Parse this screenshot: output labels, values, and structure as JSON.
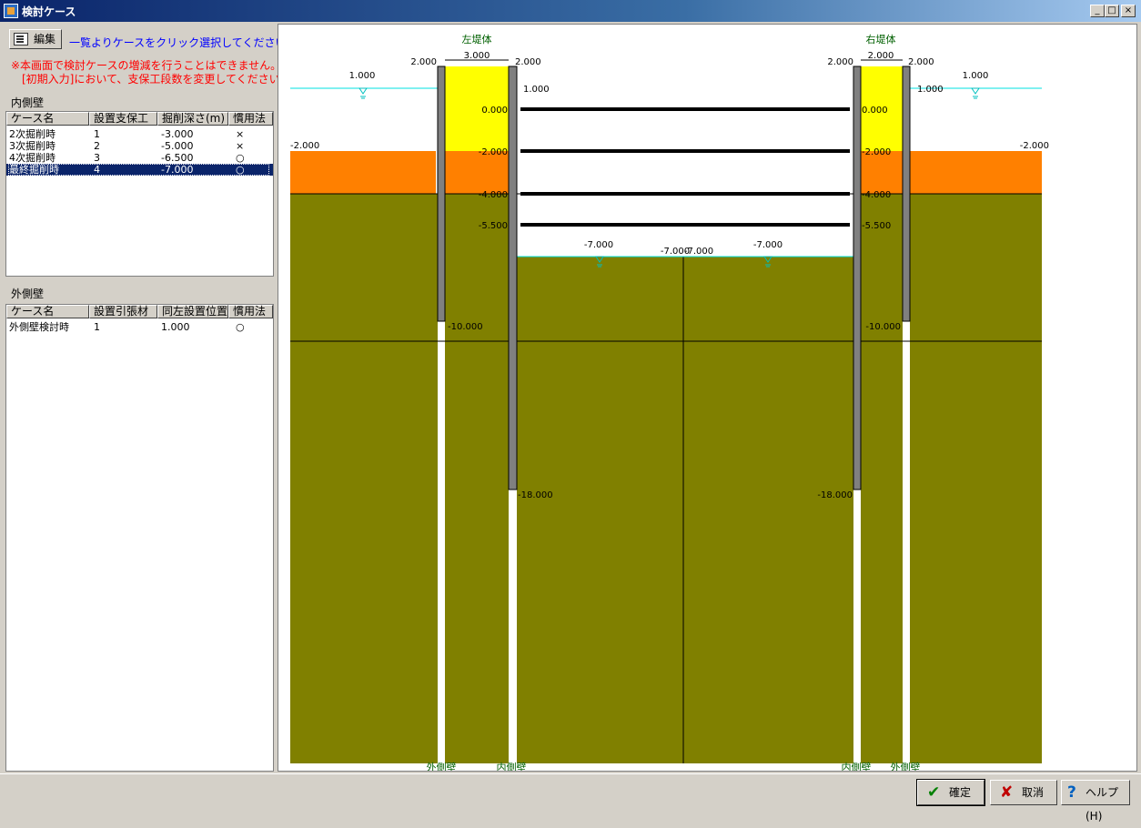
{
  "window": {
    "title": "検討ケース",
    "min": "_",
    "max": "□",
    "close": "×"
  },
  "left": {
    "edit_button": "編集",
    "hint": "一覧よりケースをクリック選択してください",
    "warning1": "※本画面で検討ケースの増減を行うことはできません。",
    "warning2": "[初期入力]において、支保工段数を変更してください。",
    "inner": {
      "title": "内側壁",
      "headers": [
        "ケース名",
        "設置支保工",
        "掘削深さ(m)",
        "慣用法"
      ],
      "rows": [
        [
          "2次掘削時",
          "1",
          "-3.000",
          "×"
        ],
        [
          "3次掘削時",
          "2",
          "-5.000",
          "×"
        ],
        [
          "4次掘削時",
          "3",
          "-6.500",
          "○"
        ],
        [
          "最終掘削時",
          "4",
          "-7.000",
          "○"
        ]
      ],
      "selected_index": 3
    },
    "outer": {
      "title": "外側壁",
      "headers": [
        "ケース名",
        "設置引張材",
        "同左設置位置",
        "慣用法"
      ],
      "rows": [
        [
          "外側壁検討時",
          "1",
          "1.000",
          "○"
        ]
      ]
    }
  },
  "diagram": {
    "labels": {
      "left_dike": "左堤体",
      "right_dike": "右堤体",
      "outer_wall": "外側壁",
      "inner_wall": "内側壁"
    },
    "dims": {
      "left_w1": "2.000",
      "left_width": "3.000",
      "left_w2": "2.000",
      "right_w1": "2.000",
      "right_width": "2.000",
      "right_w2": "2.000",
      "water_left": "1.000",
      "water_right": "1.000",
      "tie_left": "1.000",
      "tie_right": "1.000",
      "ground_left": "-2.000",
      "ground_right": "-2.000",
      "excav_1": "-7.000",
      "excav_2": "-7.000",
      "excav_3": "-7.000",
      "excav_4": "-7.000",
      "outer_toe_left": "-10.000",
      "outer_toe_right": "-10.000",
      "inner_toe_left": "-18.000",
      "inner_toe_right": "-18.000"
    },
    "struts": [
      "0.000",
      "-2.000",
      "-4.000",
      "-5.500"
    ],
    "colors": {
      "yellow": "#ffff00",
      "orange": "#ff8000",
      "olive": "#808000",
      "wall": "#808080",
      "water": "#00e0e0",
      "label_green": "#006000"
    }
  },
  "buttons": {
    "ok": "確定",
    "cancel": "取消",
    "help": "ヘルプ(H)"
  }
}
